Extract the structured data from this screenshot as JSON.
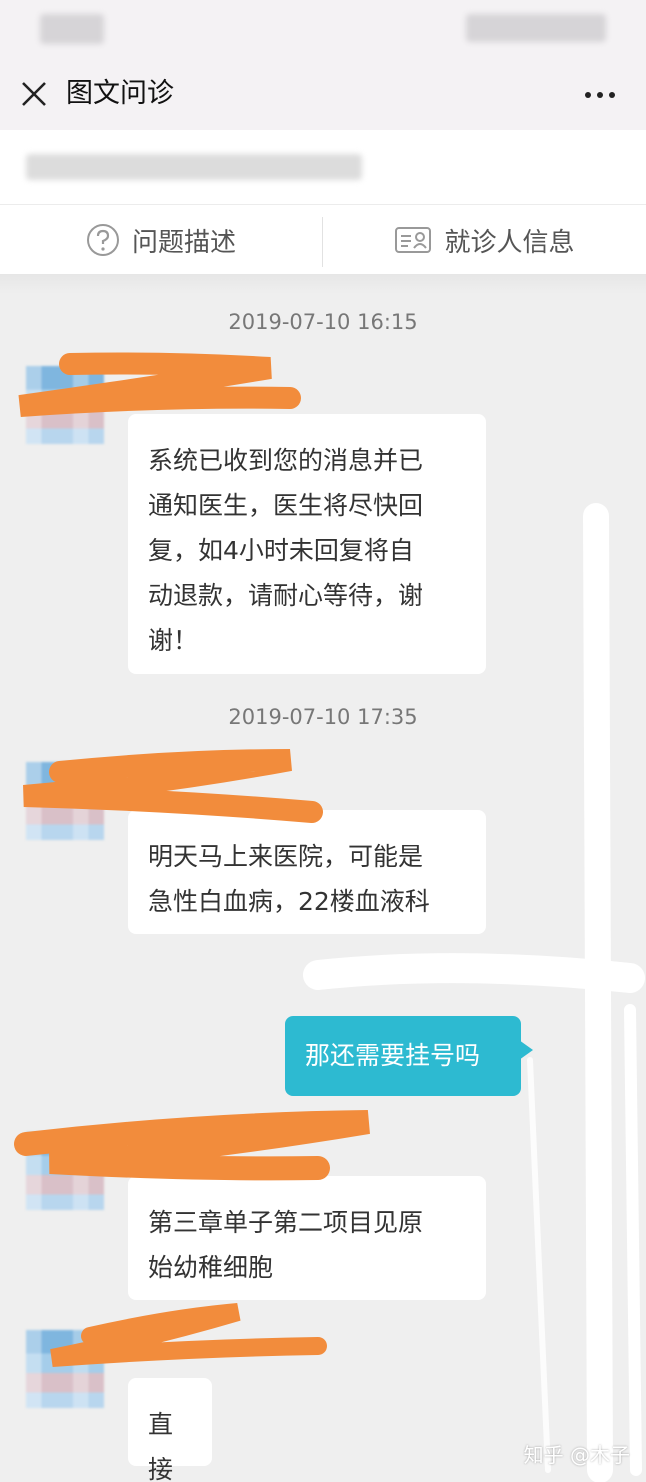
{
  "nav": {
    "title": "图文问诊"
  },
  "tabs": [
    {
      "label": "问题描述",
      "icon": "question-circle-icon"
    },
    {
      "label": "就诊人信息",
      "icon": "id-card-icon"
    }
  ],
  "chat": {
    "timestamps": [
      "2019-07-10 16:15",
      "2019-07-10 17:35"
    ],
    "messages": [
      {
        "from": "doctor",
        "lines": [
          "系统已收到您的消息并已",
          "通知医生，医生将尽快回",
          "复，如4小时未回复将自",
          "动退款，请耐心等待，谢",
          "谢！"
        ]
      },
      {
        "from": "doctor",
        "lines": [
          "明天马上来医院，可能是",
          "急性白血病，22楼血液科"
        ]
      },
      {
        "from": "me",
        "text": "那还需要挂号吗"
      },
      {
        "from": "doctor",
        "lines": [
          "第三章单子第二项目见原",
          "始幼稚细胞"
        ]
      },
      {
        "from": "doctor",
        "lines": [
          "直接"
        ]
      }
    ]
  },
  "watermark": "知乎 @木子",
  "colors": {
    "outgoing_bubble": "#2dbad1",
    "background": "#efefef",
    "scribble": "#f28c3c"
  }
}
